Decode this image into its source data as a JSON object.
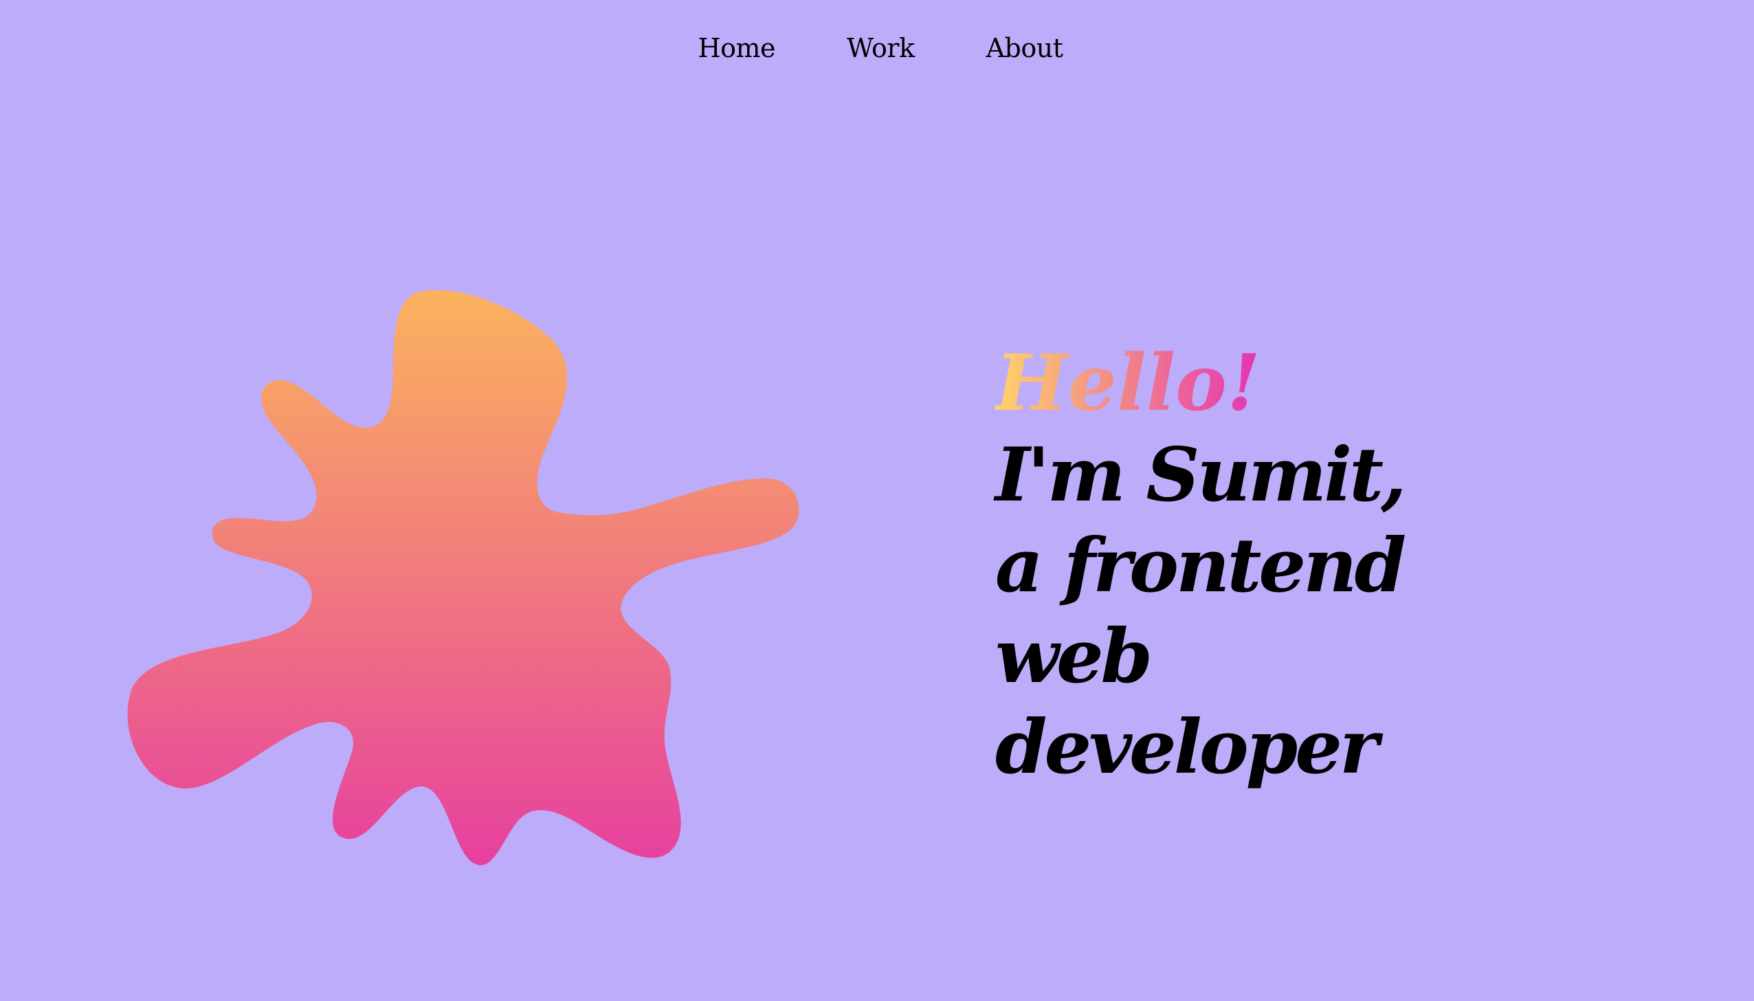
{
  "nav": {
    "items": [
      {
        "label": "Home"
      },
      {
        "label": "Work"
      },
      {
        "label": "About"
      }
    ]
  },
  "hero": {
    "greeting": "Hello!",
    "intro": "I'm Sumit, a frontend web developer"
  },
  "colors": {
    "background": "#bdacf9",
    "blob_gradient_top": "#fbb35d",
    "blob_gradient_bottom": "#e6409f",
    "greeting_gradient": [
      "#ffd36a",
      "#f28a86",
      "#e233b2"
    ],
    "text": "#000000"
  }
}
